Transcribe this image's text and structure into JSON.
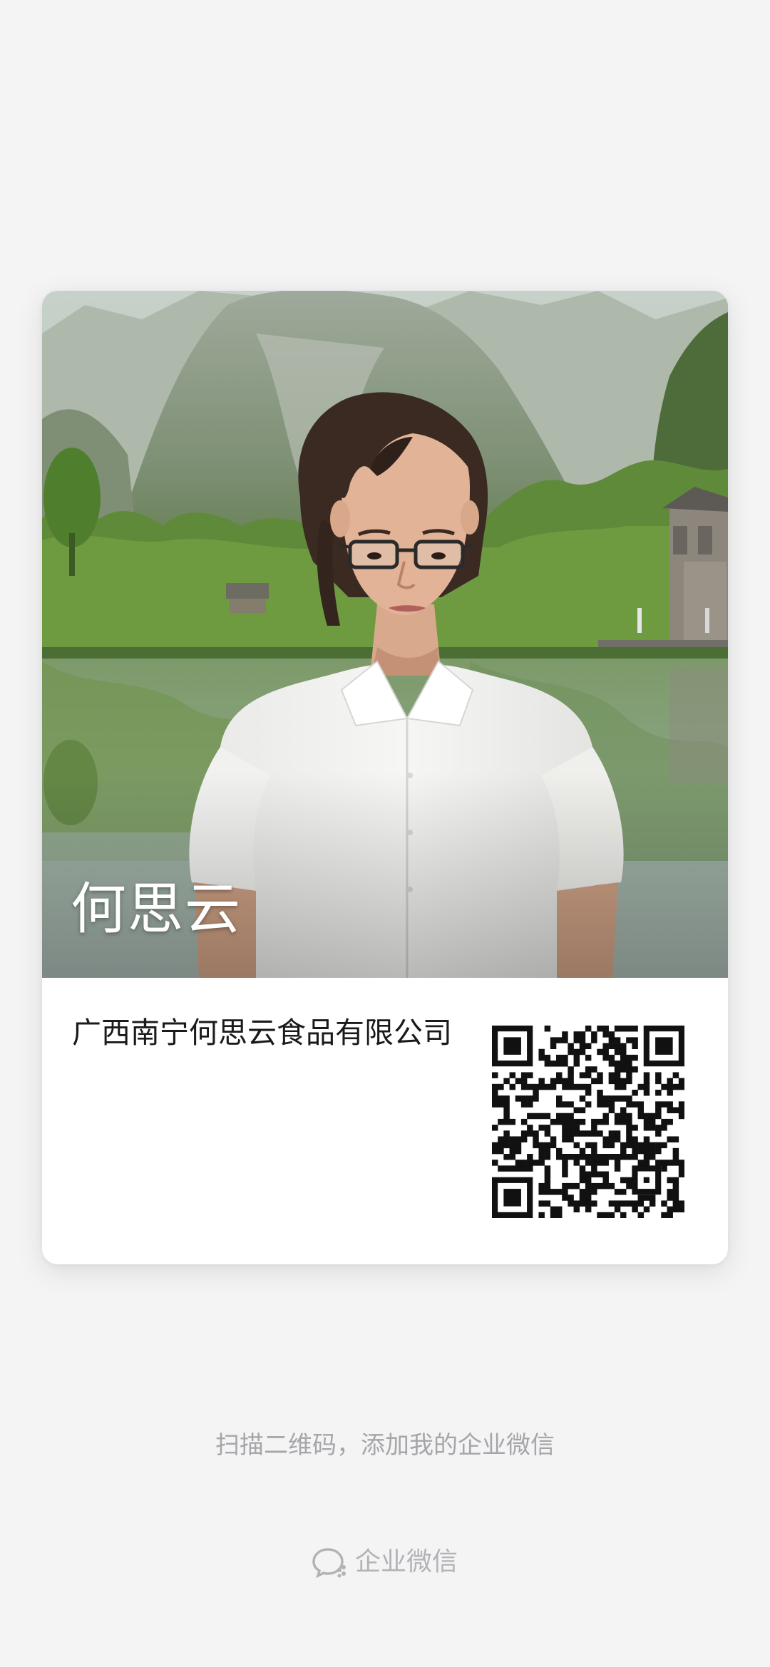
{
  "card": {
    "name": "何思云",
    "company": "广西南宁何思云食品有限公司",
    "photo_icon": "profile-photo",
    "qr_icon": "qr-code"
  },
  "footer": {
    "hint": "扫描二维码，添加我的企业微信",
    "brand_label": "企业微信",
    "brand_icon": "wecom-chat-icon"
  },
  "colors": {
    "background": "#f4f4f5",
    "card": "#ffffff",
    "hint_text": "#a6a6aa",
    "company_text": "#1a1a1a"
  }
}
